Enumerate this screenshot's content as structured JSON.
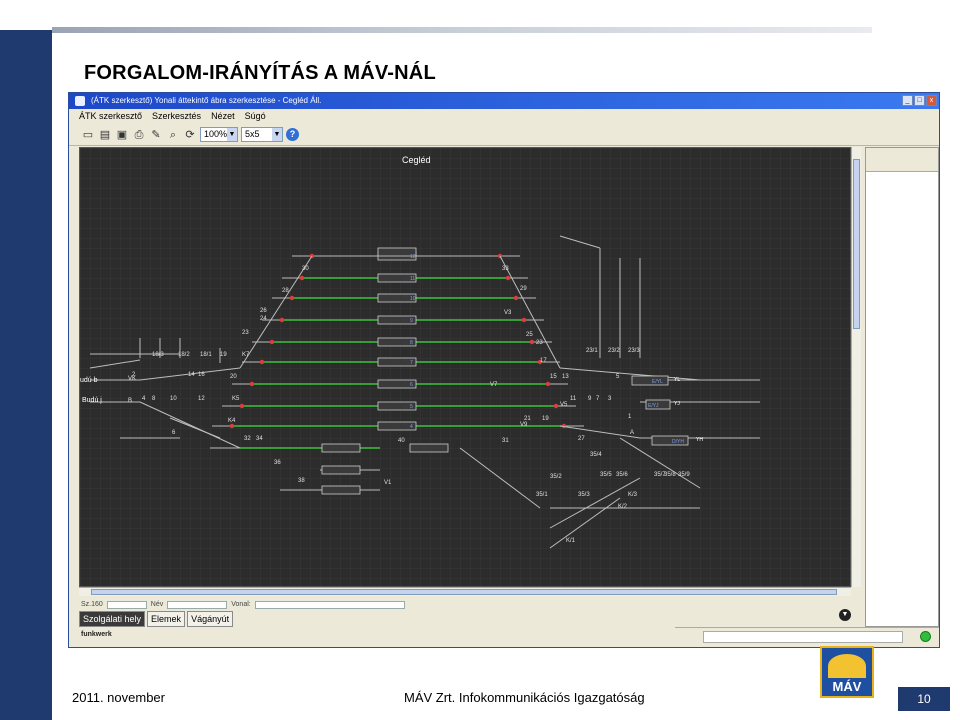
{
  "slide": {
    "title": "FORGALOM-IRÁNYÍTÁS  A MÁV-NÁL",
    "footer_date": "2011. november",
    "footer_org": "MÁV Zrt. Infokommunikációs Igazgatóság",
    "page_number": "10",
    "logo_text": "MÁV",
    "colors": {
      "brand_blue": "#1f3a6e",
      "logo_yellow": "#f2c230"
    }
  },
  "window": {
    "title": "(ÁTK szerkesztő) Yonali áttekintő ábra szerkesztése - Cegléd Áll.",
    "menu": [
      "ÁTK szerkesztő",
      "Szerkesztés",
      "Nézet",
      "Súgó"
    ],
    "toolbar": {
      "zoom": "100%",
      "grid": "5x5"
    },
    "controls": {
      "minimize": "_",
      "maximize": "□",
      "close": "x"
    }
  },
  "diagram": {
    "station": "Cegléd",
    "left_labels": [
      "udú b",
      "Budú j"
    ],
    "signal_labels": [
      "30",
      "28",
      "26",
      "24",
      "23",
      "20",
      "18/3",
      "18/2",
      "18/1",
      "19",
      "14",
      "16",
      "2",
      "4",
      "8",
      "10",
      "12",
      "6",
      "32",
      "34",
      "36",
      "38",
      "40",
      "31",
      "33",
      "29",
      "25",
      "23",
      "17",
      "15",
      "13",
      "11",
      "9",
      "7",
      "3",
      "5",
      "1",
      "21",
      "19",
      "27",
      "35/4",
      "35/2",
      "35/5",
      "35/6",
      "35/7",
      "35/8",
      "35/9",
      "35/1",
      "35/3",
      "K/3",
      "K/2",
      "K/1",
      "23/1",
      "23/2",
      "23/3",
      "K7",
      "K5",
      "K4",
      "V1",
      "V3",
      "V5",
      "V7",
      "V9",
      "VK",
      "B",
      "A",
      "L"
    ],
    "track_labels": [
      "12",
      "11",
      "10",
      "9",
      "8",
      "7",
      "6",
      "5",
      "4",
      "3",
      "2",
      "1"
    ],
    "exit_labels": [
      "E/YL",
      "E/YJ",
      "D/YH"
    ],
    "exit_tags": [
      "YL",
      "YJ",
      "YH"
    ]
  },
  "bottom": {
    "field_labels": [
      "Sz.160",
      "Név",
      "Vonal:"
    ],
    "tabs": [
      "Szolgálati hely",
      "Elemek",
      "Vágányút"
    ],
    "brand": "funkwerk"
  }
}
